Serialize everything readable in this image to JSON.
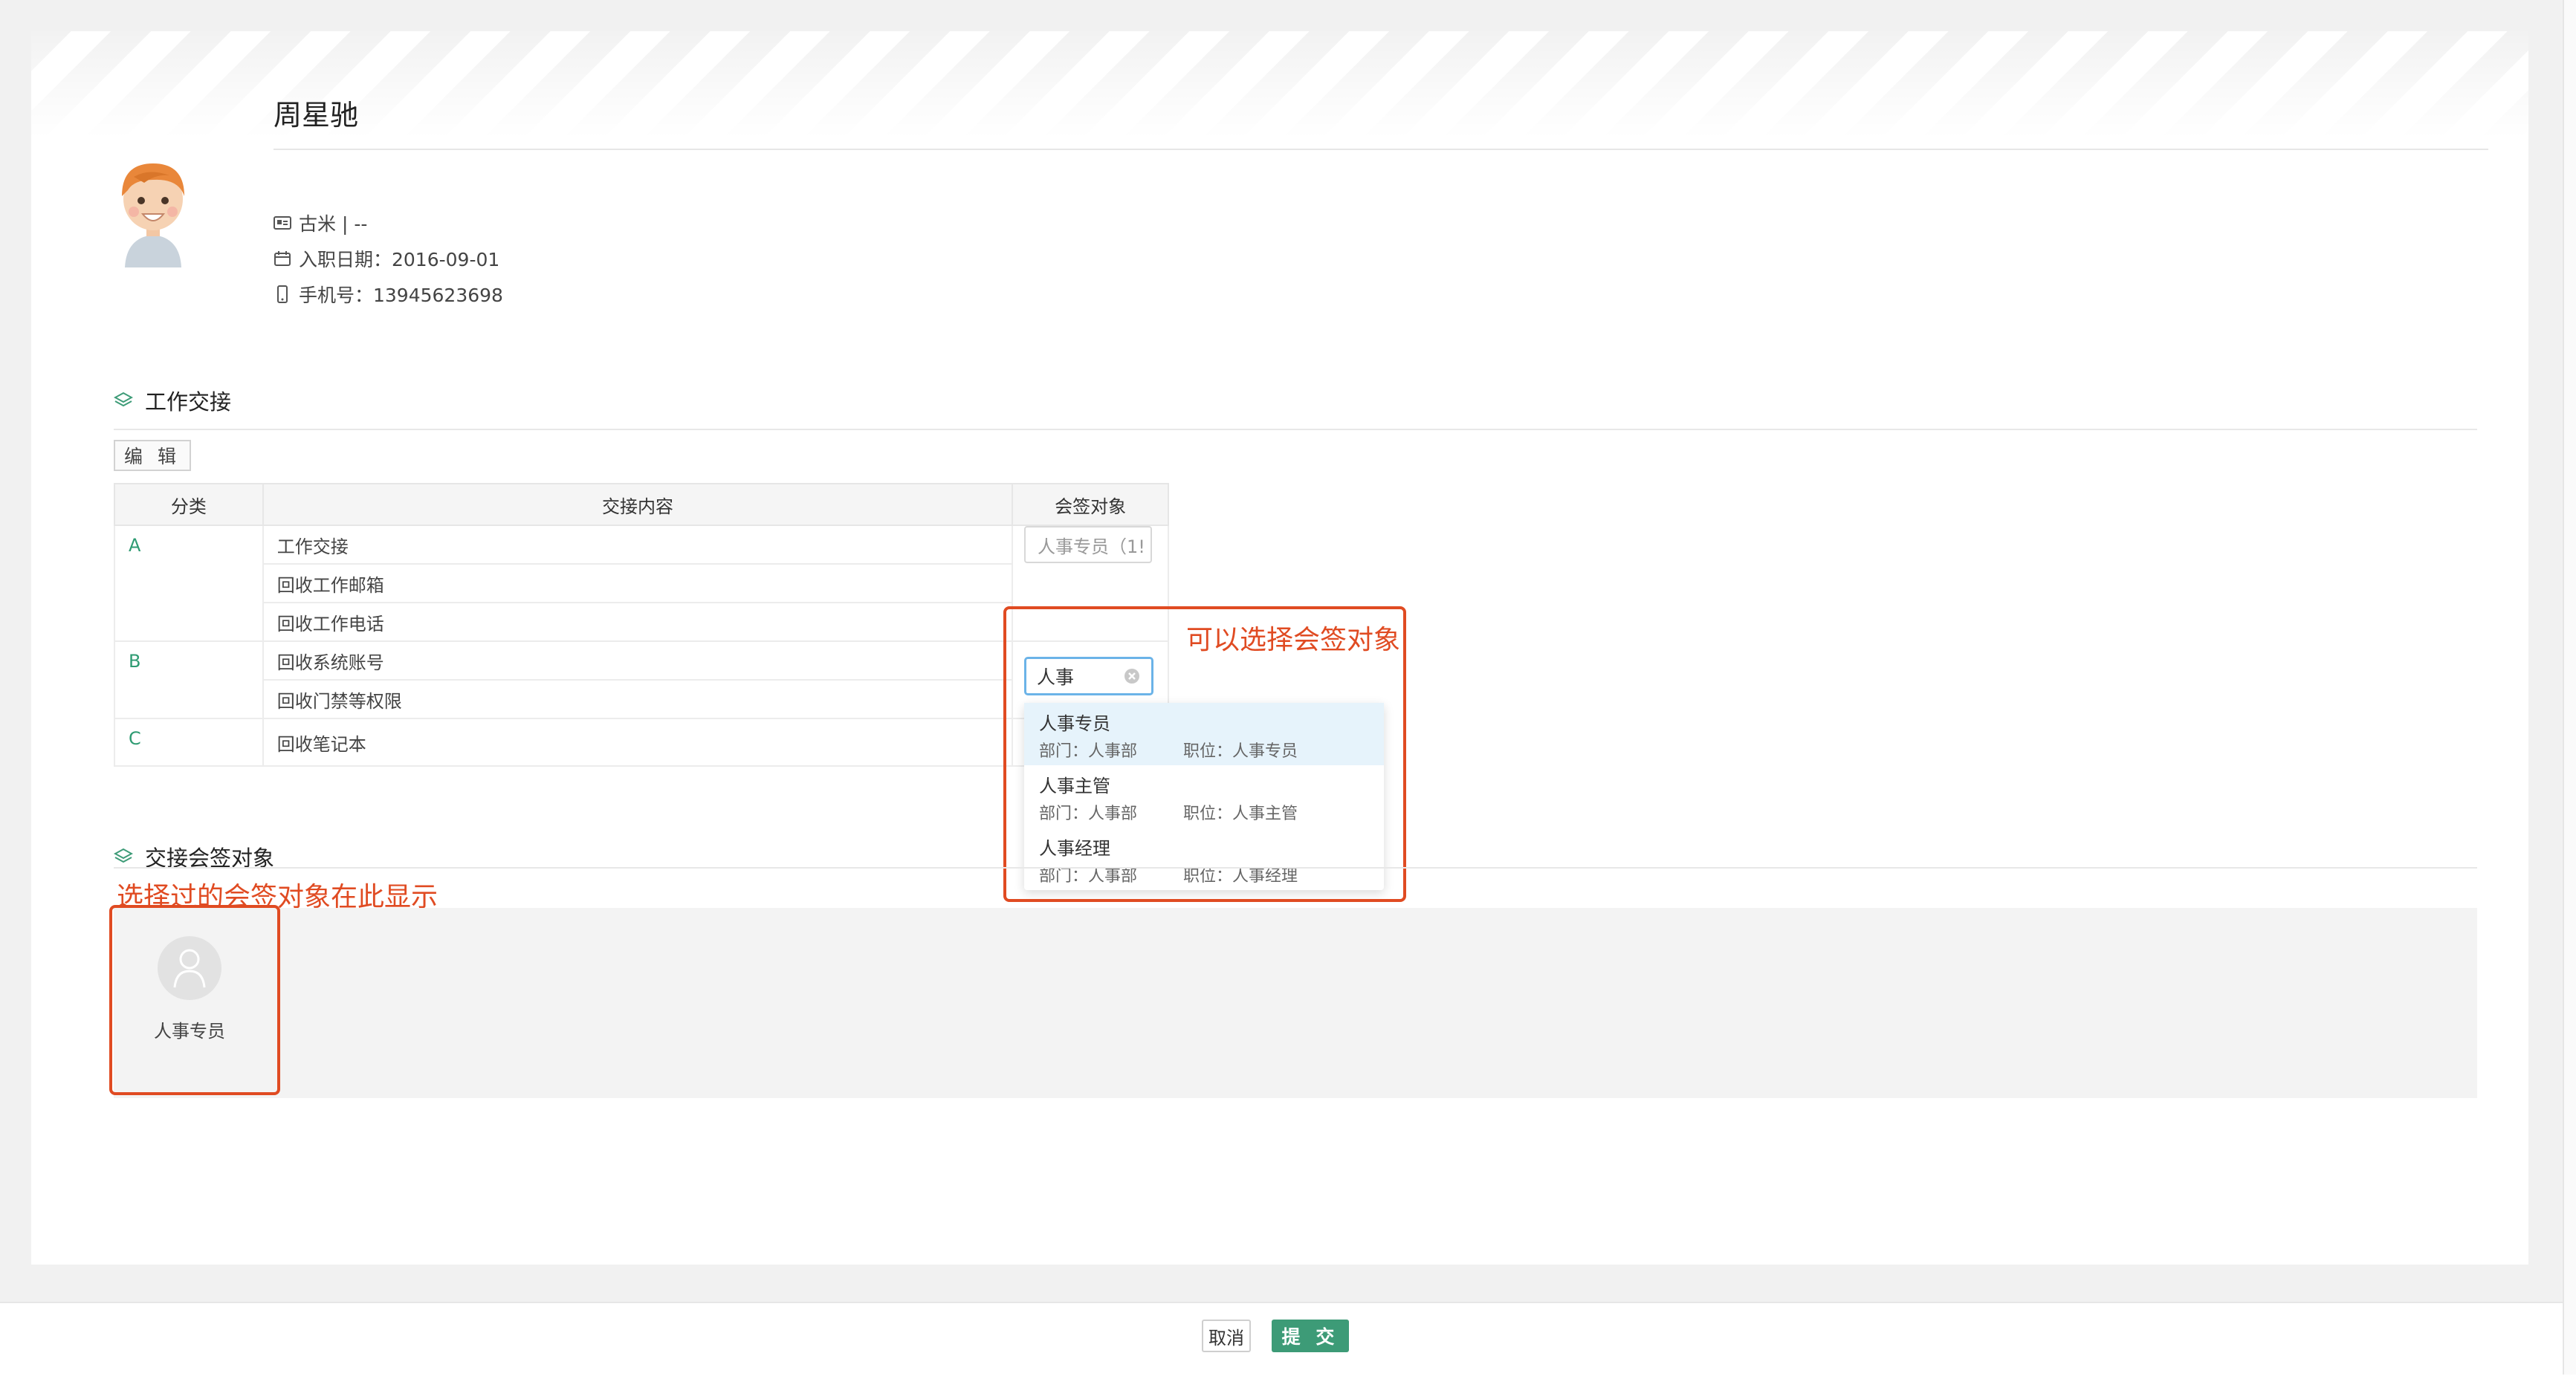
{
  "employee": {
    "name": "周星驰",
    "company": "古米 | --",
    "join_date": "入职日期：2016-09-01",
    "phone": "手机号：13945623698"
  },
  "handover_section": {
    "title": "工作交接",
    "edit_button": "编 辑",
    "columns": [
      "分类",
      "交接内容",
      "会签对象"
    ],
    "rows": [
      {
        "category": "A",
        "content": "工作交接"
      },
      {
        "category": "",
        "content": "回收工作邮箱"
      },
      {
        "category": "",
        "content": "回收工作电话"
      },
      {
        "category": "B",
        "content": "回收系统账号"
      },
      {
        "category": "",
        "content": "回收门禁等权限"
      },
      {
        "category": "C",
        "content": "回收笔记本"
      }
    ],
    "signer_input_value": "人事专员（1!",
    "search_value": "人事"
  },
  "dropdown": {
    "items": [
      {
        "name": "人事专员",
        "dept": "部门：人事部",
        "position": "职位：人事专员"
      },
      {
        "name": "人事主管",
        "dept": "部门：人事部",
        "position": "职位：人事主管"
      },
      {
        "name": "人事经理",
        "dept": "部门：人事部",
        "position": "职位：人事经理"
      }
    ]
  },
  "annotations": {
    "select_hint": "可以选择会签对象",
    "selected_hint": "选择过的会签对象在此显示"
  },
  "signers_section": {
    "title": "交接会签对象",
    "signers": [
      {
        "name": "人事专员"
      }
    ]
  },
  "footer": {
    "cancel": "取消",
    "submit": "提 交"
  },
  "colors": {
    "accent": "#3d9b77",
    "annotation": "#e04b22",
    "focus": "#6bb3e8"
  }
}
